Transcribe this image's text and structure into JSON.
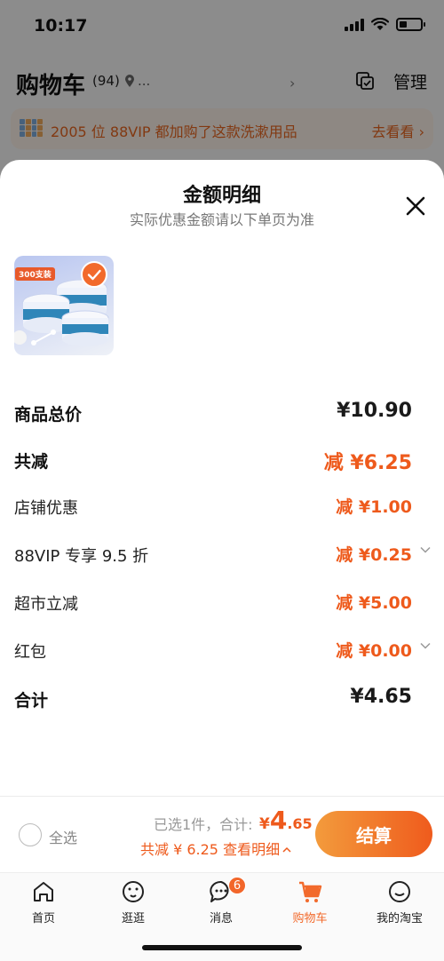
{
  "status_bar": {
    "time": "10:17"
  },
  "cart_header": {
    "title": "购物车",
    "count": "(94)",
    "location": "...",
    "manage_label": "管理"
  },
  "promo_banner": {
    "text": "2005 位 88VIP 都加购了这款洗漱用品",
    "link": "去看看 ›"
  },
  "sheet": {
    "title": "金额明细",
    "subtitle": "实际优惠金额请以下单页为准",
    "product": {
      "badge": "300支装",
      "selected": true
    },
    "rows": [
      {
        "label": "商品总价",
        "value": "¥10.90",
        "style": "total"
      },
      {
        "label": "共减",
        "value": "减 ¥6.25",
        "style": "discount-total"
      },
      {
        "label": "店铺优惠",
        "value": "减 ¥1.00",
        "style": "discount"
      },
      {
        "label": "88VIP 专享 9.5 折",
        "value": "减 ¥0.25",
        "style": "discount",
        "expandable": true
      },
      {
        "label": "超市立减",
        "value": "减 ¥5.00",
        "style": "discount"
      },
      {
        "label": "红包",
        "value": "减 ¥0.00",
        "style": "discount",
        "expandable": true
      },
      {
        "label": "合计",
        "value": "¥4.65",
        "style": "total"
      }
    ]
  },
  "checkout_bar": {
    "select_all_label": "全选",
    "selected_text": "已选1件，合计:",
    "total_currency": "¥",
    "total_int": "4",
    "total_dec": ".65",
    "discount_text": "共减 ¥ 6.25  查看明细",
    "checkout_label": "结算"
  },
  "tab_bar": {
    "tabs": [
      {
        "label": "首页",
        "icon": "home-icon"
      },
      {
        "label": "逛逛",
        "icon": "explore-icon"
      },
      {
        "label": "消息",
        "icon": "message-icon",
        "badge": "6"
      },
      {
        "label": "购物车",
        "icon": "cart-icon",
        "active": true
      },
      {
        "label": "我的淘宝",
        "icon": "profile-icon"
      }
    ]
  },
  "colors": {
    "accent": "#ee5a1c",
    "button_start": "#f39b3c",
    "button_end": "#ef5b1d"
  }
}
